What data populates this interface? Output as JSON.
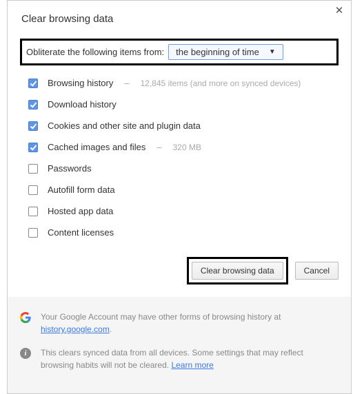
{
  "dialog": {
    "title": "Clear browsing data",
    "obliterate_label": "Obliterate the following items from:",
    "time_range_selected": "the beginning of time",
    "items": [
      {
        "label": "Browsing history",
        "meta": "12,845 items (and more on synced devices)",
        "checked": true
      },
      {
        "label": "Download history",
        "meta": "",
        "checked": true
      },
      {
        "label": "Cookies and other site and plugin data",
        "meta": "",
        "checked": true
      },
      {
        "label": "Cached images and files",
        "meta": "320 MB",
        "checked": true
      },
      {
        "label": "Passwords",
        "meta": "",
        "checked": false
      },
      {
        "label": "Autofill form data",
        "meta": "",
        "checked": false
      },
      {
        "label": "Hosted app data",
        "meta": "",
        "checked": false
      },
      {
        "label": "Content licenses",
        "meta": "",
        "checked": false
      }
    ],
    "primary_button": "Clear browsing data",
    "cancel_button": "Cancel"
  },
  "footer": {
    "google_text_pre": "Your Google Account may have other forms of browsing history at ",
    "google_link": "history.google.com",
    "google_text_post": ".",
    "sync_text": "This clears synced data from all devices. Some settings that may reflect browsing habits will not be cleared. ",
    "learn_more": "Learn more"
  }
}
